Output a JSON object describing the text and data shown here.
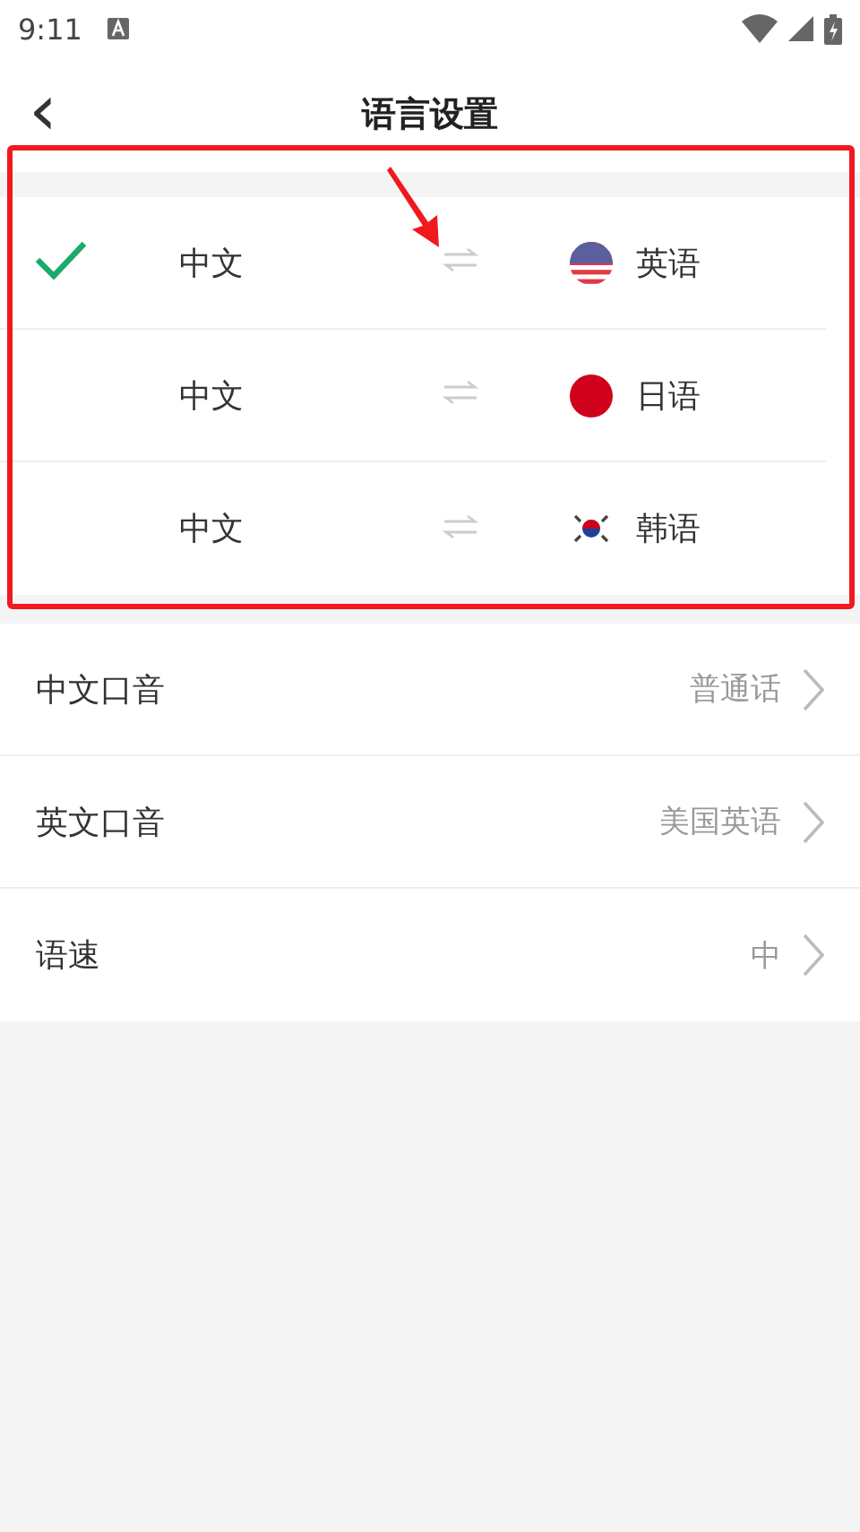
{
  "status_bar": {
    "time": "9:11"
  },
  "header": {
    "title": "语言设置",
    "back": "‹"
  },
  "language_pairs": [
    {
      "source": "中文",
      "target": "英语",
      "kind": "us",
      "selected": true
    },
    {
      "source": "中文",
      "target": "日语",
      "kind": "jp",
      "selected": false
    },
    {
      "source": "中文",
      "target": "韩语",
      "kind": "kr",
      "selected": false
    }
  ],
  "settings": [
    {
      "label": "中文口音",
      "value": "普通话"
    },
    {
      "label": "英文口音",
      "value": "美国英语"
    },
    {
      "label": "语速",
      "value": "中"
    }
  ]
}
